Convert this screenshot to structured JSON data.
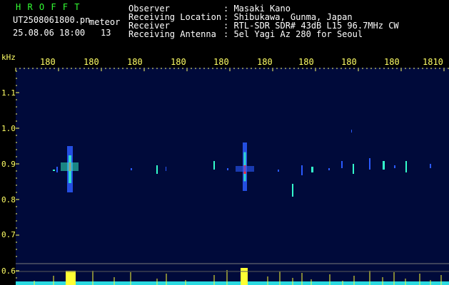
{
  "header": {
    "logo_text": "H R O F F T",
    "filename": "UT2508061800.pn",
    "mode": "meteor",
    "datetime": "25.08.06 18:00",
    "count": "13"
  },
  "station": {
    "rows": [
      {
        "label": "Observer",
        "value": ": Masaki Kano"
      },
      {
        "label": "Receiving Location",
        "value": ": Shibukawa, Gunma, Japan"
      },
      {
        "label": "Receiver",
        "value": ": RTL-SDR SDR# 43dB L15 96.7MHz CW"
      },
      {
        "label": "Receiving Antenna",
        "value": ": 5el Yagi Az 280 for Seoul"
      }
    ]
  },
  "axes": {
    "y_unit": "kHz",
    "x_ticks": [
      "180",
      "180",
      "180",
      "180",
      "180",
      "180",
      "180",
      "180",
      "180",
      "1810"
    ],
    "y_ticks": [
      "1.1",
      "1.0",
      "0.9",
      "0.8",
      "0.7",
      "0.6"
    ]
  },
  "colors": {
    "background": "#000000",
    "plot_background": "#000a3a",
    "tick_color": "#ffff66",
    "logo_color": "#33ff33",
    "meteor_hot": "#ff3030",
    "meteor_mid": "#33ffcc",
    "meteor_low": "#2a5aff",
    "bottom_activity": "#ffff33",
    "bottom_baseline": "#33ffff"
  }
}
